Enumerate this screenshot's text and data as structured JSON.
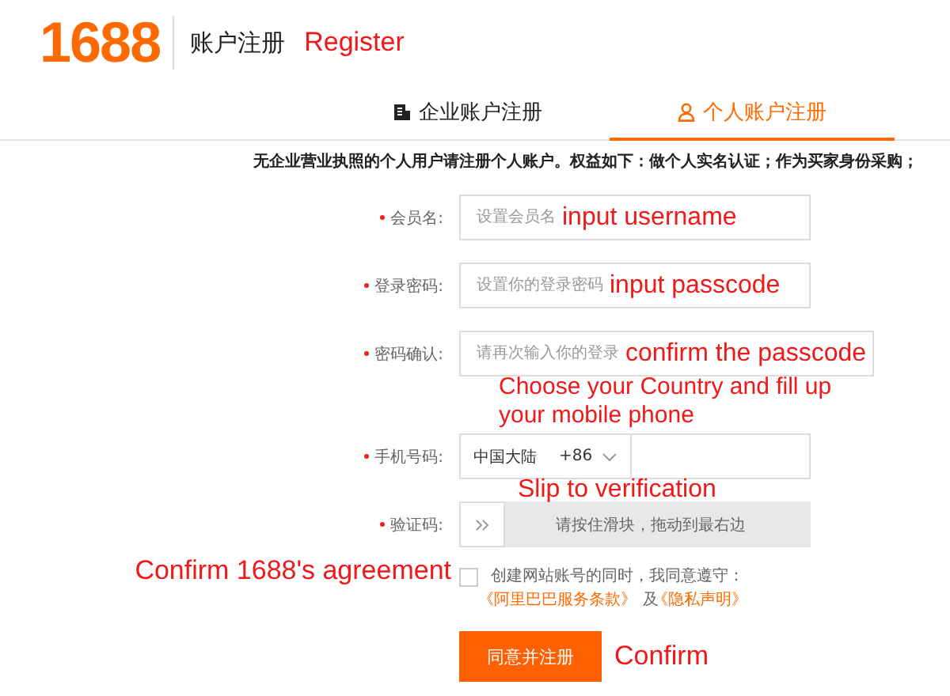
{
  "header": {
    "logo": "1688",
    "title": "账户注册",
    "annotation": "Register"
  },
  "tabs": [
    {
      "label": "企业账户注册",
      "selected": false
    },
    {
      "label": "个人账户注册",
      "selected": true
    }
  ],
  "notice": "无企业营业执照的个人用户请注册个人账户。权益如下：做个人实名认证；作为买家身份采购；",
  "fields": [
    {
      "kind": "text",
      "label": "会员名:",
      "required": true,
      "placeholder": "设置会员名",
      "annotation": "input username"
    },
    {
      "kind": "text",
      "label": "登录密码:",
      "required": true,
      "placeholder": "设置你的登录密码",
      "annotation": "input passcode"
    },
    {
      "kind": "text",
      "label": "密码确认:",
      "required": true,
      "placeholder": "请再次输入你的登录",
      "annotation": "confirm the passcode"
    },
    {
      "kind": "phone",
      "label": "手机号码:",
      "required": true,
      "country": "中国大陆",
      "code": "+86",
      "annotation": "Choose your Country and fill up your mobile phone"
    },
    {
      "kind": "slider",
      "label": "验证码:",
      "required": true,
      "hint": "请按住滑块，拖动到最右边",
      "annotation": "Slip to verification"
    }
  ],
  "agreement": {
    "checked": false,
    "text": "创建网站账号的同时，我同意遵守：",
    "links": [
      "《阿里巴巴服务条款》",
      "《隐私声明》"
    ],
    "joiner": "及",
    "annotation": "Confirm 1688's agreement"
  },
  "submit": {
    "label": "同意并注册",
    "annotation": "Confirm"
  }
}
